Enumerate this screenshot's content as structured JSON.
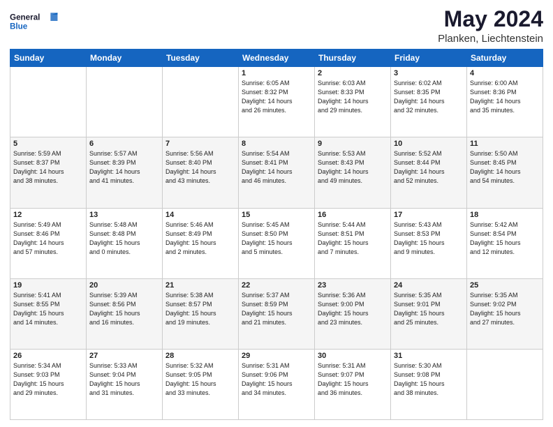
{
  "header": {
    "logo_general": "General",
    "logo_blue": "Blue",
    "month_title": "May 2024",
    "location": "Planken, Liechtenstein"
  },
  "weekdays": [
    "Sunday",
    "Monday",
    "Tuesday",
    "Wednesday",
    "Thursday",
    "Friday",
    "Saturday"
  ],
  "weeks": [
    [
      {
        "day": "",
        "info": ""
      },
      {
        "day": "",
        "info": ""
      },
      {
        "day": "",
        "info": ""
      },
      {
        "day": "1",
        "info": "Sunrise: 6:05 AM\nSunset: 8:32 PM\nDaylight: 14 hours\nand 26 minutes."
      },
      {
        "day": "2",
        "info": "Sunrise: 6:03 AM\nSunset: 8:33 PM\nDaylight: 14 hours\nand 29 minutes."
      },
      {
        "day": "3",
        "info": "Sunrise: 6:02 AM\nSunset: 8:35 PM\nDaylight: 14 hours\nand 32 minutes."
      },
      {
        "day": "4",
        "info": "Sunrise: 6:00 AM\nSunset: 8:36 PM\nDaylight: 14 hours\nand 35 minutes."
      }
    ],
    [
      {
        "day": "5",
        "info": "Sunrise: 5:59 AM\nSunset: 8:37 PM\nDaylight: 14 hours\nand 38 minutes."
      },
      {
        "day": "6",
        "info": "Sunrise: 5:57 AM\nSunset: 8:39 PM\nDaylight: 14 hours\nand 41 minutes."
      },
      {
        "day": "7",
        "info": "Sunrise: 5:56 AM\nSunset: 8:40 PM\nDaylight: 14 hours\nand 43 minutes."
      },
      {
        "day": "8",
        "info": "Sunrise: 5:54 AM\nSunset: 8:41 PM\nDaylight: 14 hours\nand 46 minutes."
      },
      {
        "day": "9",
        "info": "Sunrise: 5:53 AM\nSunset: 8:43 PM\nDaylight: 14 hours\nand 49 minutes."
      },
      {
        "day": "10",
        "info": "Sunrise: 5:52 AM\nSunset: 8:44 PM\nDaylight: 14 hours\nand 52 minutes."
      },
      {
        "day": "11",
        "info": "Sunrise: 5:50 AM\nSunset: 8:45 PM\nDaylight: 14 hours\nand 54 minutes."
      }
    ],
    [
      {
        "day": "12",
        "info": "Sunrise: 5:49 AM\nSunset: 8:46 PM\nDaylight: 14 hours\nand 57 minutes."
      },
      {
        "day": "13",
        "info": "Sunrise: 5:48 AM\nSunset: 8:48 PM\nDaylight: 15 hours\nand 0 minutes."
      },
      {
        "day": "14",
        "info": "Sunrise: 5:46 AM\nSunset: 8:49 PM\nDaylight: 15 hours\nand 2 minutes."
      },
      {
        "day": "15",
        "info": "Sunrise: 5:45 AM\nSunset: 8:50 PM\nDaylight: 15 hours\nand 5 minutes."
      },
      {
        "day": "16",
        "info": "Sunrise: 5:44 AM\nSunset: 8:51 PM\nDaylight: 15 hours\nand 7 minutes."
      },
      {
        "day": "17",
        "info": "Sunrise: 5:43 AM\nSunset: 8:53 PM\nDaylight: 15 hours\nand 9 minutes."
      },
      {
        "day": "18",
        "info": "Sunrise: 5:42 AM\nSunset: 8:54 PM\nDaylight: 15 hours\nand 12 minutes."
      }
    ],
    [
      {
        "day": "19",
        "info": "Sunrise: 5:41 AM\nSunset: 8:55 PM\nDaylight: 15 hours\nand 14 minutes."
      },
      {
        "day": "20",
        "info": "Sunrise: 5:39 AM\nSunset: 8:56 PM\nDaylight: 15 hours\nand 16 minutes."
      },
      {
        "day": "21",
        "info": "Sunrise: 5:38 AM\nSunset: 8:57 PM\nDaylight: 15 hours\nand 19 minutes."
      },
      {
        "day": "22",
        "info": "Sunrise: 5:37 AM\nSunset: 8:59 PM\nDaylight: 15 hours\nand 21 minutes."
      },
      {
        "day": "23",
        "info": "Sunrise: 5:36 AM\nSunset: 9:00 PM\nDaylight: 15 hours\nand 23 minutes."
      },
      {
        "day": "24",
        "info": "Sunrise: 5:35 AM\nSunset: 9:01 PM\nDaylight: 15 hours\nand 25 minutes."
      },
      {
        "day": "25",
        "info": "Sunrise: 5:35 AM\nSunset: 9:02 PM\nDaylight: 15 hours\nand 27 minutes."
      }
    ],
    [
      {
        "day": "26",
        "info": "Sunrise: 5:34 AM\nSunset: 9:03 PM\nDaylight: 15 hours\nand 29 minutes."
      },
      {
        "day": "27",
        "info": "Sunrise: 5:33 AM\nSunset: 9:04 PM\nDaylight: 15 hours\nand 31 minutes."
      },
      {
        "day": "28",
        "info": "Sunrise: 5:32 AM\nSunset: 9:05 PM\nDaylight: 15 hours\nand 33 minutes."
      },
      {
        "day": "29",
        "info": "Sunrise: 5:31 AM\nSunset: 9:06 PM\nDaylight: 15 hours\nand 34 minutes."
      },
      {
        "day": "30",
        "info": "Sunrise: 5:31 AM\nSunset: 9:07 PM\nDaylight: 15 hours\nand 36 minutes."
      },
      {
        "day": "31",
        "info": "Sunrise: 5:30 AM\nSunset: 9:08 PM\nDaylight: 15 hours\nand 38 minutes."
      },
      {
        "day": "",
        "info": ""
      }
    ]
  ]
}
